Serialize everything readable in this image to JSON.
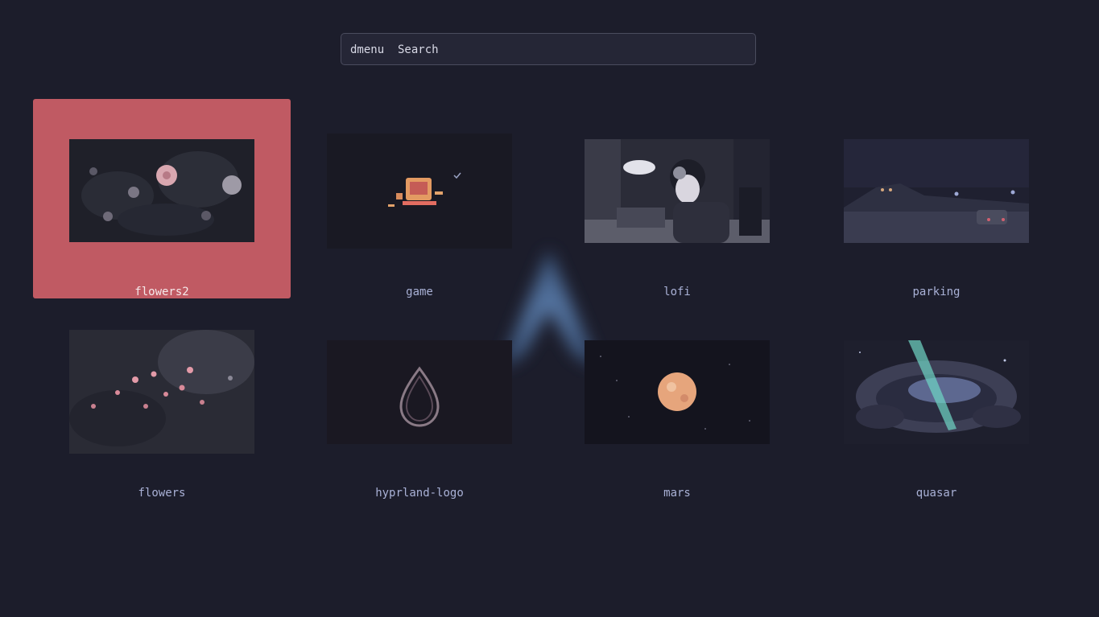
{
  "search": {
    "value": "dmenu  Search"
  },
  "wallpapers": [
    {
      "label": "flowers2",
      "selected": true
    },
    {
      "label": "game",
      "selected": false
    },
    {
      "label": "lofi",
      "selected": false
    },
    {
      "label": "parking",
      "selected": false
    },
    {
      "label": "flowers",
      "selected": false
    },
    {
      "label": "hyprland-logo",
      "selected": false
    },
    {
      "label": "mars",
      "selected": false
    },
    {
      "label": "quasar",
      "selected": false
    }
  ],
  "colors": {
    "background": "#1c1d2b",
    "selected_accent": "#c05a63",
    "label": "#a9b1d6"
  }
}
